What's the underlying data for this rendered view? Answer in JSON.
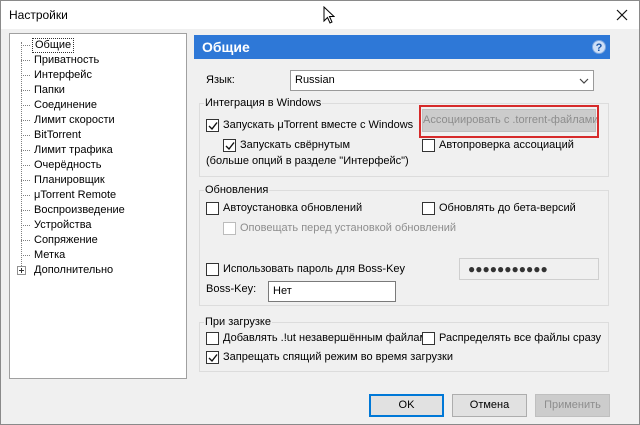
{
  "window": {
    "title": "Настройки"
  },
  "sidebar": {
    "items": [
      {
        "label": "Общие",
        "selected": true
      },
      {
        "label": "Приватность"
      },
      {
        "label": "Интерфейс"
      },
      {
        "label": "Папки"
      },
      {
        "label": "Соединение"
      },
      {
        "label": "Лимит скорости"
      },
      {
        "label": "BitTorrent"
      },
      {
        "label": "Лимит трафика"
      },
      {
        "label": "Очерёдность"
      },
      {
        "label": "Планировщик"
      },
      {
        "label": "μTorrent Remote"
      },
      {
        "label": "Воспроизведение"
      },
      {
        "label": "Устройства"
      },
      {
        "label": "Сопряжение"
      },
      {
        "label": "Метка"
      },
      {
        "label": "Дополнительно",
        "expandable": true
      }
    ]
  },
  "panel": {
    "title": "Общие",
    "help_icon": "?"
  },
  "language": {
    "label": "Язык:",
    "value": "Russian"
  },
  "windows_integration": {
    "group_title": "Интеграция в Windows",
    "start_with_windows": {
      "label": "Запускать μTorrent вместе с Windows",
      "checked": true
    },
    "associate_button": "Ассоциировать с .torrent-файлами",
    "start_minimized": {
      "label": "Запускать свёрнутым",
      "checked": true
    },
    "more_options_note": "(больше опций в разделе \"Интерфейс\")",
    "auto_check_associations": {
      "label": "Автопроверка ассоциаций",
      "checked": false
    }
  },
  "updates": {
    "group_title": "Обновления",
    "auto_install": {
      "label": "Автоустановка обновлений",
      "checked": false
    },
    "update_to_beta": {
      "label": "Обновлять до бета-версий",
      "checked": false
    },
    "notify_before_install": {
      "label": "Оповещать перед установкой обновлений",
      "checked": false
    },
    "use_boss_key_password": {
      "label": "Использовать пароль для Boss-Key",
      "checked": false
    },
    "password_value": "●●●●●●●●●●●",
    "boss_key_label": "Boss-Key:",
    "boss_key_value": "Нет"
  },
  "on_download": {
    "group_title": "При загрузке",
    "add_ut_extension": {
      "label": "Добавлять .!ut незавершённым файлам",
      "checked": false
    },
    "preallocate_files": {
      "label": "Распределять все файлы сразу",
      "checked": false
    },
    "prevent_standby": {
      "label": "Запрещать спящий режим во время загрузки",
      "checked": true
    }
  },
  "buttons": {
    "ok": "OK",
    "cancel": "Отмена",
    "apply": "Применить"
  },
  "colors": {
    "accent": "#2e78d7",
    "highlight": "#d62a2a"
  }
}
